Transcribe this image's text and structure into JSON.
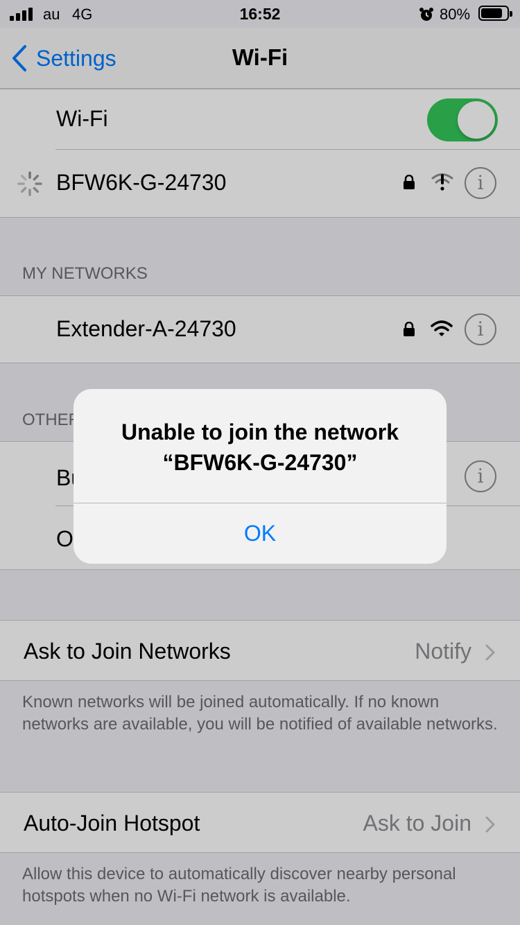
{
  "status_bar": {
    "carrier": "au",
    "network": "4G",
    "time": "16:52",
    "battery": "80%"
  },
  "nav": {
    "back_label": "Settings",
    "title": "Wi-Fi"
  },
  "wifi_toggle": {
    "label": "Wi-Fi",
    "on": true
  },
  "current_network": {
    "name": "BFW6K-G-24730",
    "status": "joining"
  },
  "my_networks": {
    "header": "MY NETWORKS",
    "items": [
      {
        "name": "Extender-A-24730",
        "secured": true
      }
    ]
  },
  "other_networks": {
    "header": "OTHER",
    "items": [
      {
        "name": "Bu"
      },
      {
        "name": "O"
      }
    ]
  },
  "ask_to_join": {
    "label": "Ask to Join Networks",
    "value": "Notify",
    "footer": "Known networks will be joined automatically. If no known networks are available, you will be notified of available networks."
  },
  "auto_join_hotspot": {
    "label": "Auto-Join Hotspot",
    "value": "Ask to Join",
    "footer": "Allow this device to automatically discover nearby personal hotspots when no Wi-Fi network is available."
  },
  "alert": {
    "title_line1": "Unable to join the network",
    "title_line2": "“BFW6K-G-24730”",
    "ok_label": "OK"
  },
  "colors": {
    "accent": "#007aff",
    "toggle_on": "#34c759",
    "secondary_text": "#8e8e93"
  }
}
